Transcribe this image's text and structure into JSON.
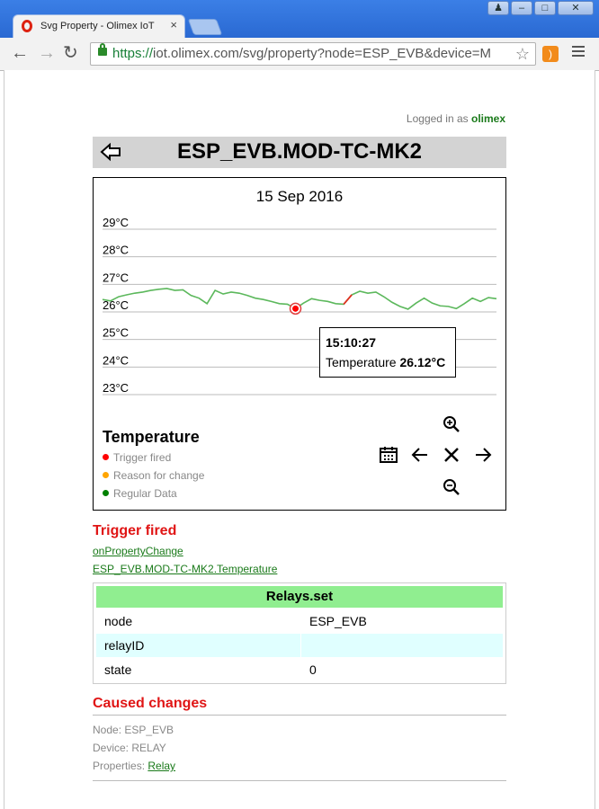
{
  "browser": {
    "tab_title": "Svg Property - Olimex IoT Se",
    "tab_close": "×",
    "url_scheme": "https://",
    "url_rest": "iot.olimex.com/svg/property?node=ESP_EVB&device=M",
    "win_user": "♟",
    "win_min": "–",
    "win_max": "□",
    "win_close": "✕",
    "back": "←",
    "forward": "→",
    "reload": "↻",
    "star": "☆",
    "rss": ")"
  },
  "page": {
    "login_prefix": "Logged in as ",
    "login_user": "olimex",
    "title": "ESP_EVB.MOD-TC-MK2"
  },
  "chart": {
    "date": "15 Sep 2016",
    "tooltip_time": "15:10:27",
    "tooltip_label": "Temperature ",
    "tooltip_value": "26.12°C",
    "legend_title": "Temperature",
    "legend": [
      {
        "label": "Trigger fired",
        "color": "#ff0000"
      },
      {
        "label": "Reason for change",
        "color": "#ffa500"
      },
      {
        "label": "Regular Data",
        "color": "#008000"
      }
    ],
    "controls": {
      "zoom_in": "⊕",
      "zoom_out": "⊖",
      "prev": "←",
      "reset": "✕",
      "next": "→",
      "calendar": "▦"
    }
  },
  "chart_data": {
    "type": "line",
    "title": "15 Sep 2016",
    "yticks": [
      "29°C",
      "28°C",
      "27°C",
      "26°C",
      "25°C",
      "24°C",
      "23°C"
    ],
    "ylim": [
      23,
      29
    ],
    "series": [
      {
        "name": "Temperature",
        "color": "#5cb85c",
        "values": [
          26.45,
          26.4,
          26.55,
          26.62,
          26.68,
          26.72,
          26.78,
          26.82,
          26.85,
          26.78,
          26.8,
          26.6,
          26.5,
          26.3,
          26.78,
          26.65,
          26.72,
          26.68,
          26.6,
          26.5,
          26.45,
          26.38,
          26.3,
          26.28,
          26.12,
          26.32,
          26.48,
          26.42,
          26.38,
          26.3,
          26.28,
          26.62,
          26.75,
          26.68,
          26.72,
          26.55,
          26.35,
          26.2,
          26.1,
          26.32,
          26.5,
          26.32,
          26.22,
          26.2,
          26.12,
          26.3,
          26.5,
          26.38,
          26.52,
          26.48
        ]
      }
    ],
    "highlight": {
      "index": 24,
      "time": "15:10:27",
      "value": 26.12,
      "color": "#ff0000"
    }
  },
  "trigger": {
    "heading": "Trigger fired",
    "link1": "onPropertyChange",
    "link2": "ESP_EVB.MOD-TC-MK2.Temperature"
  },
  "relays": {
    "title": "Relays.set",
    "rows": [
      {
        "key": "node",
        "value": "ESP_EVB"
      },
      {
        "key": "relayID",
        "value": ""
      },
      {
        "key": "state",
        "value": "0"
      }
    ]
  },
  "changes": {
    "heading": "Caused changes",
    "node": "Node: ESP_EVB",
    "device": "Device: RELAY",
    "properties_label": "Properties: ",
    "properties_link": "Relay"
  }
}
